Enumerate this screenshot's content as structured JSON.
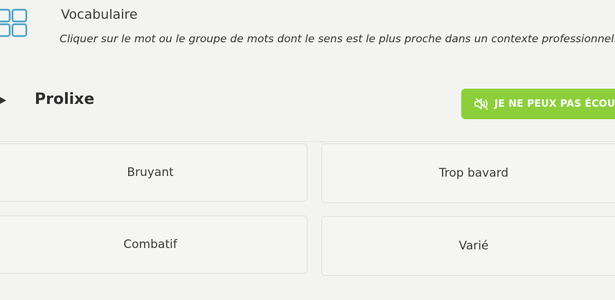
{
  "header": {
    "title": "Vocabulaire",
    "instruction": "Cliquer sur le mot ou le groupe de mots dont le sens est le plus proche dans un contexte professionnel."
  },
  "question": {
    "word": "Prolixe"
  },
  "listen_button": {
    "label": "JE NE PEUX PAS ÉCOU",
    "icon": "speaker-muted-icon",
    "color": "#8ccf3a"
  },
  "options": [
    {
      "label": "Bruyant"
    },
    {
      "label": "Trop bavard"
    },
    {
      "label": "Combatif"
    },
    {
      "label": "Varié"
    }
  ],
  "colors": {
    "accent": "#8ccf3a",
    "background": "#f3f4f2"
  }
}
